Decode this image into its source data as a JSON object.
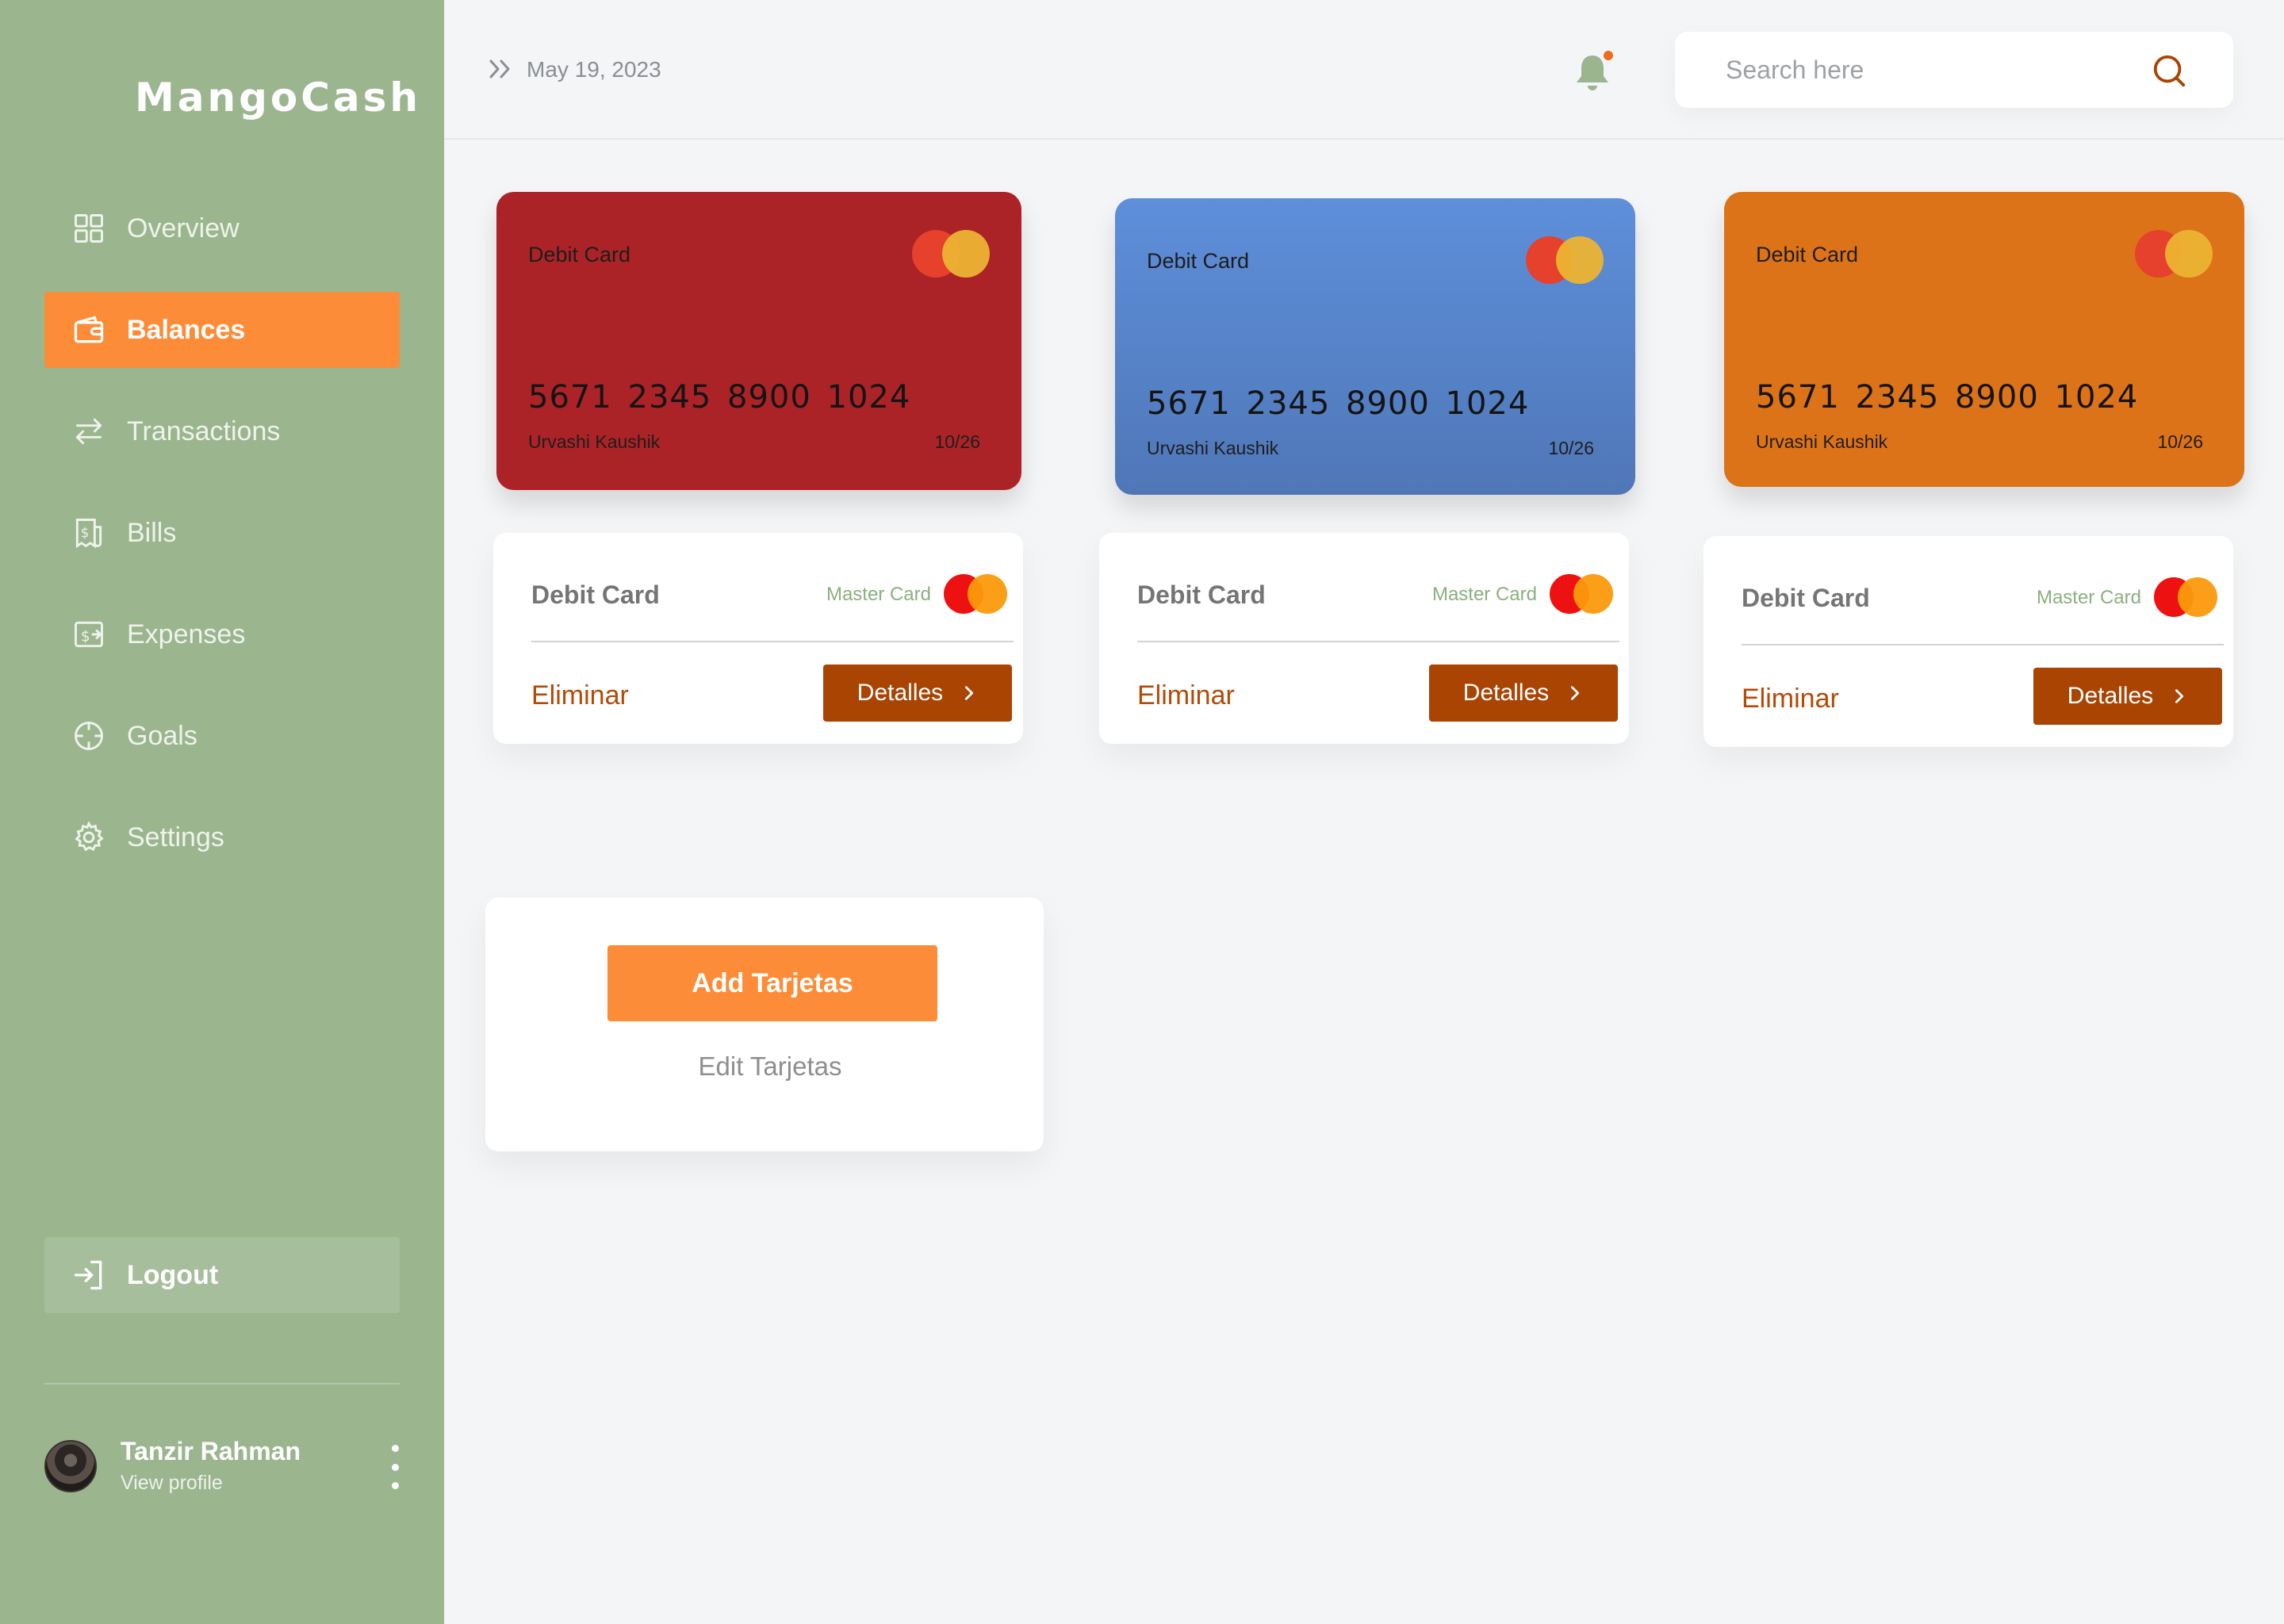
{
  "app": {
    "name": "MangoCash"
  },
  "sidebar": {
    "items": [
      {
        "label": "Overview",
        "icon": "grid-icon",
        "active": false
      },
      {
        "label": "Balances",
        "icon": "wallet-icon",
        "active": true
      },
      {
        "label": "Transactions",
        "icon": "arrows-swap-icon",
        "active": false
      },
      {
        "label": "Bills",
        "icon": "bill-icon",
        "active": false
      },
      {
        "label": "Expenses",
        "icon": "expense-icon",
        "active": false
      },
      {
        "label": "Goals",
        "icon": "crosshair-icon",
        "active": false
      },
      {
        "label": "Settings",
        "icon": "gear-icon",
        "active": false
      }
    ],
    "logout": "Logout",
    "profile": {
      "name": "Tanzir Rahman",
      "link": "View profile"
    }
  },
  "header": {
    "date": "May 19, 2023",
    "search_placeholder": "Search here"
  },
  "cards": [
    {
      "type": "Debit Card",
      "number": "5671 2345 8900 1024",
      "holder": "Urvashi Kaushik",
      "expiry": "10/26",
      "color": "#ab2327"
    },
    {
      "type": "Debit Card",
      "number": "5671 2345 8900 1024",
      "holder": "Urvashi Kaushik",
      "expiry": "10/26",
      "color": "#5a88d4"
    },
    {
      "type": "Debit Card",
      "number": "5671 2345 8900 1024",
      "holder": "Urvashi Kaushik",
      "expiry": "10/26",
      "color": "#dd7319"
    }
  ],
  "panels": [
    {
      "title": "Debit Card",
      "brand": "Master Card",
      "delete": "Eliminar",
      "details": "Detalles"
    },
    {
      "title": "Debit Card",
      "brand": "Master Card",
      "delete": "Eliminar",
      "details": "Detalles"
    },
    {
      "title": "Debit Card",
      "brand": "Master Card",
      "delete": "Eliminar",
      "details": "Detalles"
    }
  ],
  "actions": {
    "add": "Add Tarjetas",
    "edit": "Edit Tarjetas"
  },
  "colors": {
    "sidebar": "#9bb58f",
    "accent": "#fc8c37",
    "button_dark": "#a94403"
  }
}
